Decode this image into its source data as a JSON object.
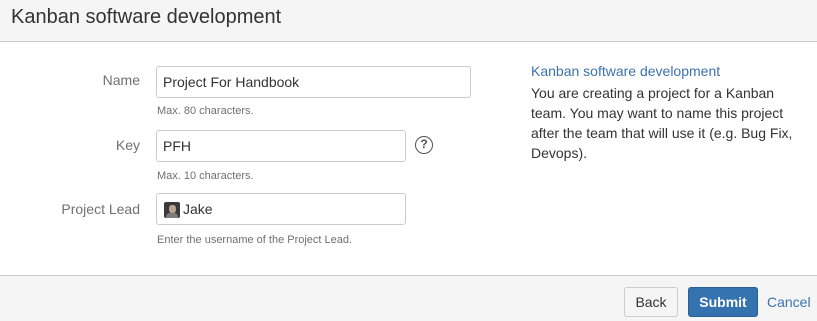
{
  "header": {
    "title": "Kanban software development"
  },
  "form": {
    "name": {
      "label": "Name",
      "value": "Project For Handbook",
      "hint": "Max. 80 characters."
    },
    "key": {
      "label": "Key",
      "value": "PFH",
      "hint": "Max. 10 characters.",
      "help_glyph": "?"
    },
    "lead": {
      "label": "Project Lead",
      "value": "Jake",
      "hint": "Enter the username of the Project Lead."
    }
  },
  "sidebar": {
    "title": "Kanban software development",
    "description": "You are creating a project for a Kanban team. You may want to name this project after the team that will use it (e.g. Bug Fix, Devops)."
  },
  "footer": {
    "back_label": "Back",
    "submit_label": "Submit",
    "cancel_label": "Cancel"
  },
  "colors": {
    "link": "#3b73af",
    "primary_button": "#3572b0"
  },
  "icons": {
    "help": "question-circle-icon",
    "avatar": "user-avatar-icon"
  }
}
